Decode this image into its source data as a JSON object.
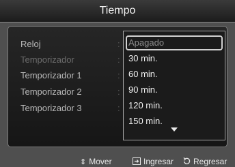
{
  "title": "Tiempo",
  "menu": [
    {
      "label": "Reloj",
      "enabled": true
    },
    {
      "label": "Temporizador",
      "enabled": false
    },
    {
      "label": "Temporizador 1",
      "enabled": true
    },
    {
      "label": "Temporizador 2",
      "enabled": true
    },
    {
      "label": "Temporizador 3",
      "enabled": true
    }
  ],
  "dropdown": {
    "options": [
      "Apagado",
      "30 min.",
      "60 min.",
      "90 min.",
      "120 min.",
      "150 min."
    ],
    "selected": "Apagado",
    "more_below": true
  },
  "footer": {
    "move": {
      "icon": "up-down-arrows-icon",
      "label": "Mover"
    },
    "enter": {
      "icon": "enter-icon",
      "label": "Ingresar"
    },
    "return": {
      "icon": "return-icon",
      "label": "Regresar"
    }
  },
  "colors": {
    "background": "#4f4f4f",
    "panel": "#1f1f1f",
    "text": "#f0f0f0",
    "dim_text": "#6c6c6c"
  }
}
